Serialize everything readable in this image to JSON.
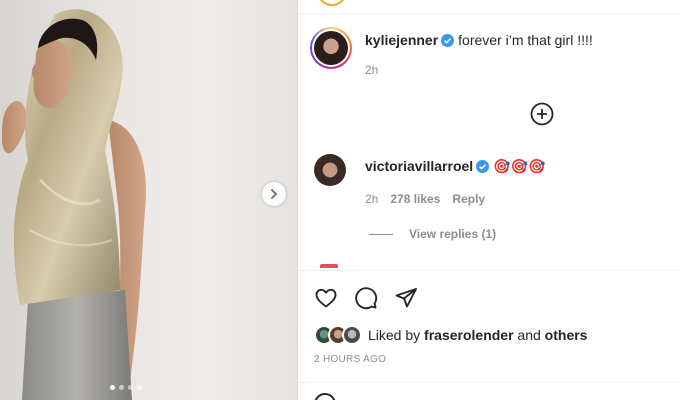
{
  "post": {
    "carousel": {
      "slide_count": 4,
      "active_index": 0
    }
  },
  "caption": {
    "username": "kyliejenner",
    "text": "forever i’m that girl !!!!",
    "time": "2h",
    "verified": true
  },
  "comments": [
    {
      "username": "victoriavillarroel",
      "text": "🎯🎯🎯",
      "time": "2h",
      "likes": "278 likes",
      "reply_label": "Reply",
      "view_replies": "View replies (1)",
      "verified": true
    }
  ],
  "likes_summary": {
    "prefix": "Liked by",
    "user": "fraserolender",
    "joiner": "and",
    "suffix": "others"
  },
  "timestamp": "2 HOURS AGO",
  "colors": {
    "verified": "#3897f0",
    "text": "#262626",
    "secondary": "#8e8e8e",
    "divider": "#efefef"
  },
  "icons": {
    "next": "chevron-right-icon",
    "load_more": "plus-circle-icon",
    "like": "heart-icon",
    "comment": "comment-icon",
    "share": "paper-plane-icon"
  }
}
